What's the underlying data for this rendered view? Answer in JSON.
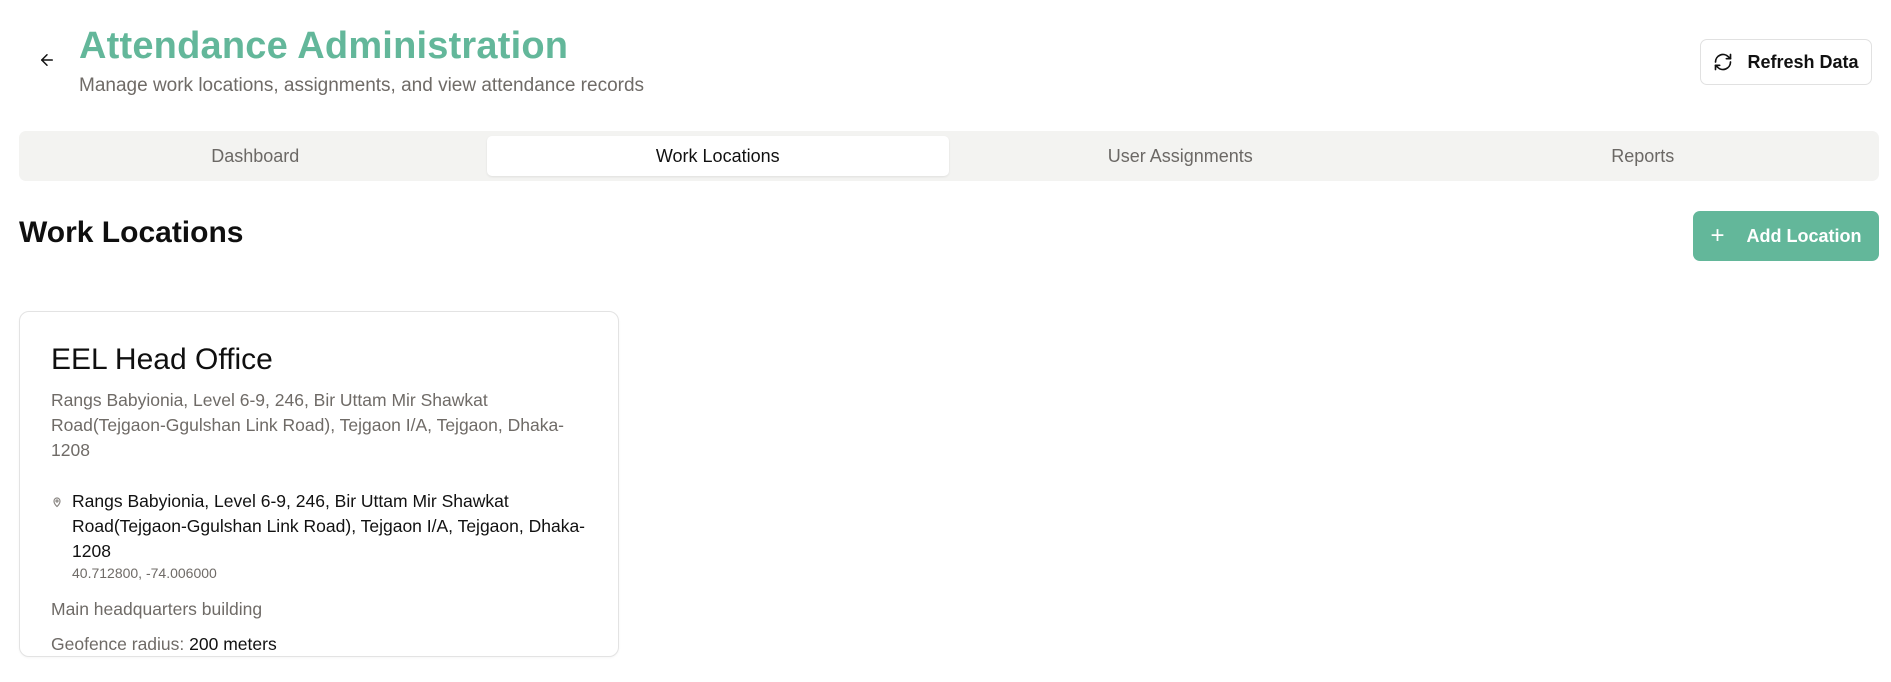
{
  "header": {
    "title": "Attendance Administration",
    "subtitle": "Manage work locations, assignments, and view attendance records",
    "refresh_label": "Refresh Data"
  },
  "tabs": [
    {
      "label": "Dashboard",
      "active": false
    },
    {
      "label": "Work Locations",
      "active": true
    },
    {
      "label": "User Assignments",
      "active": false
    },
    {
      "label": "Reports",
      "active": false
    }
  ],
  "section": {
    "title": "Work Locations",
    "add_label": "Add Location"
  },
  "locations": [
    {
      "name": "EEL Head Office",
      "address_summary": "Rangs Babyionia, Level 6-9, 246, Bir Uttam Mir Shawkat Road(Tejgaon-Ggulshan Link Road), Tejgaon I/A, Tejgaon, Dhaka-1208",
      "address": "Rangs Babyionia, Level 6-9, 246, Bir Uttam Mir Shawkat Road(Tejgaon-Ggulshan Link Road), Tejgaon I/A, Tejgaon, Dhaka-1208",
      "coordinates": "40.712800, -74.006000",
      "description": "Main headquarters building",
      "geofence_label": "Geofence radius:",
      "geofence_value": "200 meters"
    }
  ],
  "icons": {
    "back": "arrow-left-icon",
    "refresh": "refresh-icon",
    "add": "plus-icon",
    "location": "map-pin-icon"
  },
  "colors": {
    "accent": "#63b79a",
    "muted_text": "#6f6b67",
    "tab_background": "#f3f3f1"
  }
}
